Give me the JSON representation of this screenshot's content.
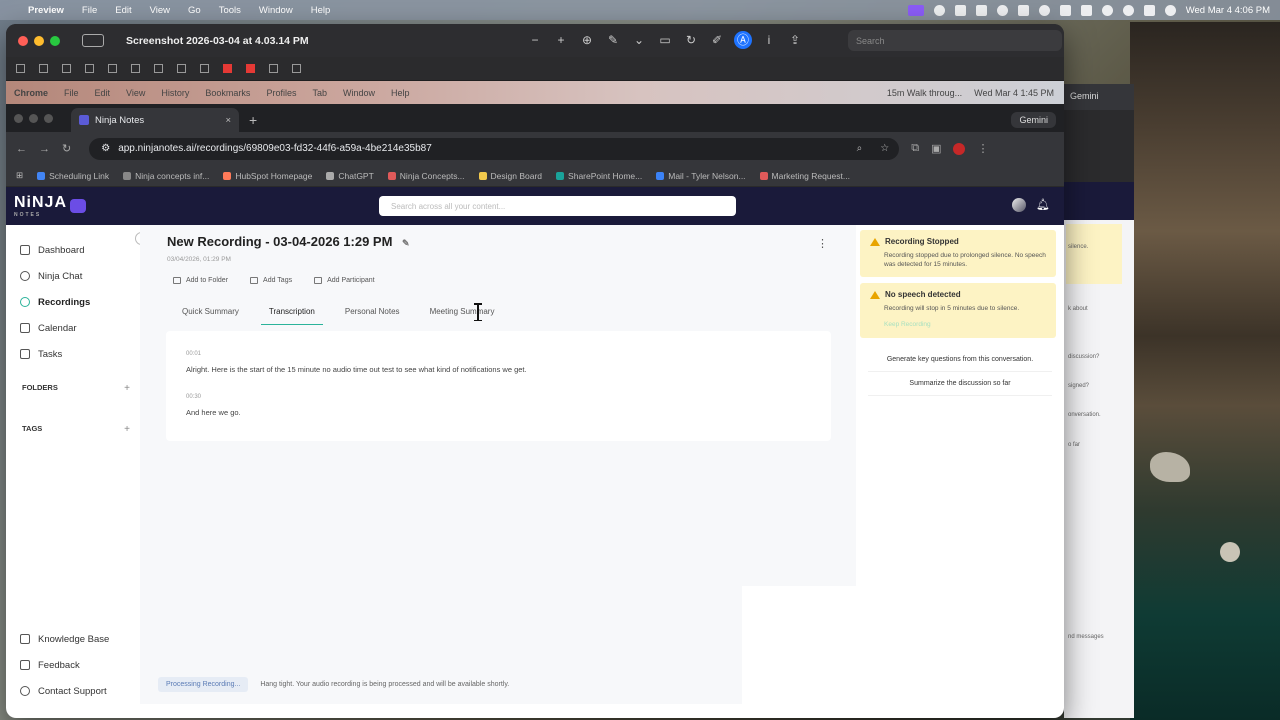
{
  "menubar": {
    "app": "Preview",
    "items": [
      "File",
      "Edit",
      "View",
      "Go",
      "Tools",
      "Window",
      "Help"
    ],
    "clock": "Wed Mar 4  4:06 PM"
  },
  "preview": {
    "title": "Screenshot 2026-03-04 at 4.03.14 PM",
    "search_placeholder": "Search"
  },
  "chrome_menubar": {
    "items": [
      "Chrome",
      "File",
      "Edit",
      "View",
      "History",
      "Bookmarks",
      "Profiles",
      "Tab",
      "Window",
      "Help"
    ],
    "meeting": "15m  Walk throug...",
    "clock": "Wed Mar 4  1:45 PM"
  },
  "chrome": {
    "tab_title": "Ninja Notes",
    "gemini": "Gemini",
    "url": "app.ninjanotes.ai/recordings/69809e03-fd32-44f6-a59a-4be214e35b87",
    "bookmarks": [
      {
        "label": "Scheduling Link",
        "color": "#4285f4"
      },
      {
        "label": "Ninja concepts inf...",
        "color": "#888888"
      },
      {
        "label": "HubSpot Homepage",
        "color": "#ff7a59"
      },
      {
        "label": "ChatGPT",
        "color": "#aaaaaa"
      },
      {
        "label": "Ninja Concepts...",
        "color": "#e05a5a"
      },
      {
        "label": "Design Board",
        "color": "#f2c94c"
      },
      {
        "label": "SharePoint Home...",
        "color": "#1aa39a"
      },
      {
        "label": "Mail - Tyler Nelson...",
        "color": "#3b82f6"
      },
      {
        "label": "Marketing Request...",
        "color": "#e05a5a"
      }
    ]
  },
  "ninja": {
    "logo": "NiNJA",
    "logo_sub": "NOTES",
    "search_placeholder": "Search across all your content...",
    "nav": [
      {
        "label": "Dashboard"
      },
      {
        "label": "Ninja Chat"
      },
      {
        "label": "Recordings"
      },
      {
        "label": "Calendar"
      },
      {
        "label": "Tasks"
      }
    ],
    "folders_label": "FOLDERS",
    "tags_label": "TAGS",
    "bottom_nav": [
      {
        "label": "Knowledge Base"
      },
      {
        "label": "Feedback"
      },
      {
        "label": "Contact Support"
      }
    ],
    "recording": {
      "title": "New Recording - 03-04-2026 1:29 PM",
      "date": "03/04/2026, 01:29 PM",
      "actions": [
        "Add to Folder",
        "Add Tags",
        "Add Participant"
      ],
      "tabs": [
        "Quick Summary",
        "Transcription",
        "Personal Notes",
        "Meeting Summary"
      ],
      "segments": [
        {
          "ts": "00:01",
          "text": "Alright. Here is the start of the 15 minute no audio time out test to see what kind of notifications we get."
        },
        {
          "ts": "00:30",
          "text": "And here we go."
        }
      ]
    },
    "status": {
      "badge": "Processing Recording...",
      "message": "Hang tight. Your audio recording is being processed and will be available shortly."
    },
    "notices": [
      {
        "title": "Recording Stopped",
        "body": "Recording stopped due to prolonged silence. No speech was detected for 15 minutes."
      },
      {
        "title": "No speech detected",
        "body": "Recording will stop in 5 minutes due to silence.",
        "link": "Keep Recording"
      }
    ],
    "suggestions": [
      "Generate key questions from this conversation.",
      "Summarize the discussion so far"
    ]
  },
  "bg_window": {
    "gemini": "Gemini",
    "texts": [
      "silence.",
      "k about",
      "discussion?",
      "signed?",
      "onversation.",
      "o far",
      "nd messages"
    ]
  }
}
